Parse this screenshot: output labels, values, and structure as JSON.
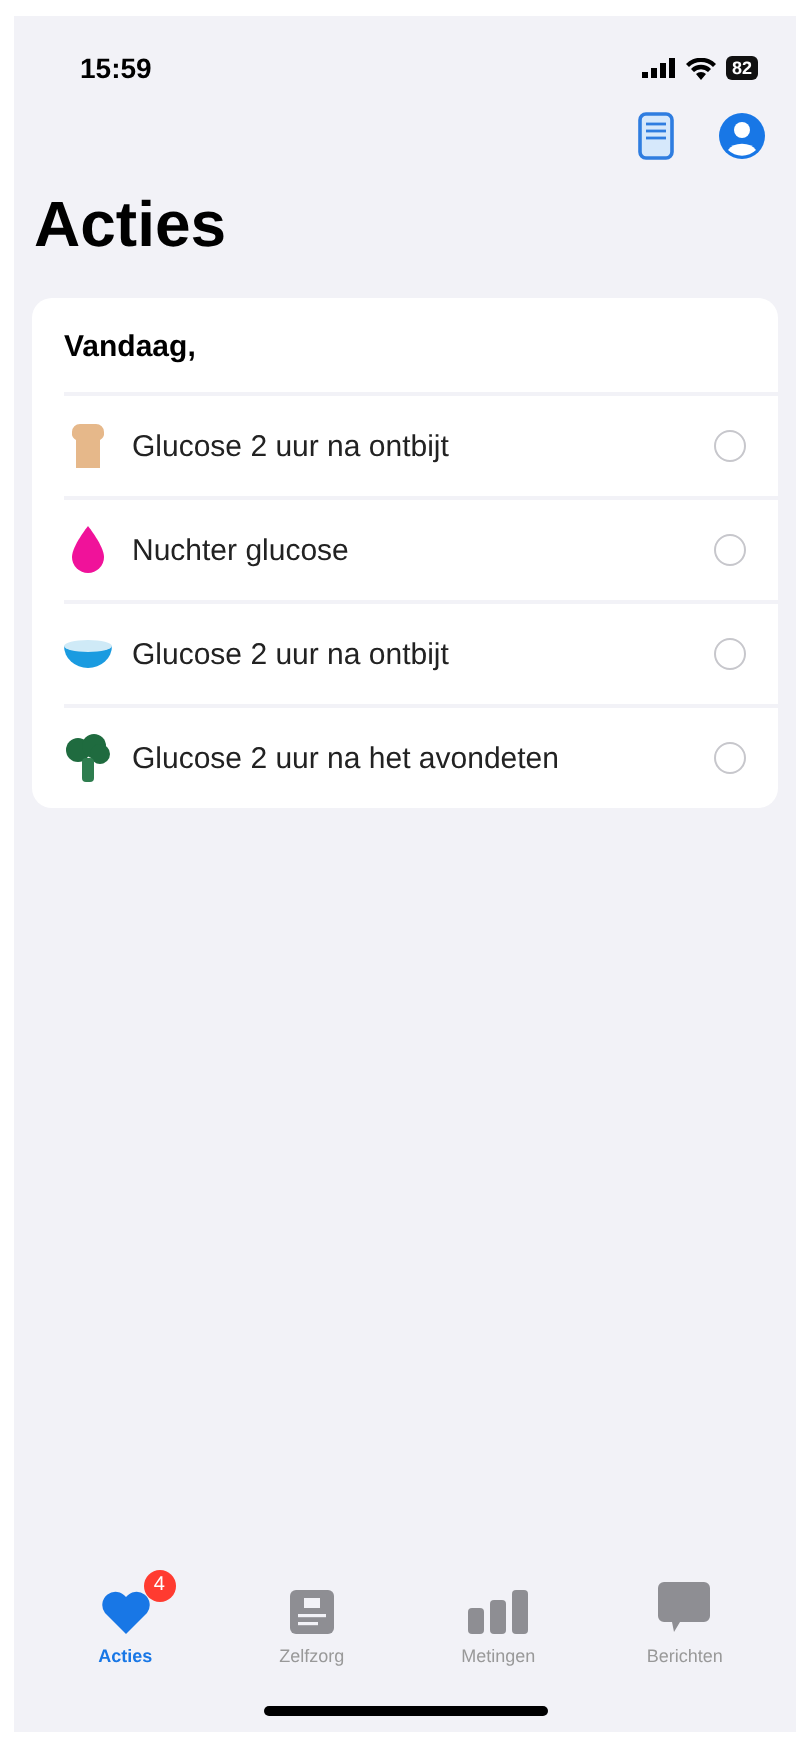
{
  "status_bar": {
    "time": "15:59",
    "battery": "82"
  },
  "title": "Acties",
  "section": {
    "heading": "Vandaag,",
    "items": [
      {
        "kind": "bread",
        "label": "Glucose 2 uur na ontbijt",
        "checked": false
      },
      {
        "kind": "drop",
        "label": "Nuchter glucose",
        "checked": false
      },
      {
        "kind": "bowl",
        "label": "Glucose 2 uur na ontbijt",
        "checked": false
      },
      {
        "kind": "broccoli",
        "label": "Glucose 2 uur na het avondeten",
        "checked": false
      }
    ]
  },
  "tabs": [
    {
      "kind": "heart",
      "label": "Acties",
      "selected": true,
      "badge": "4"
    },
    {
      "kind": "card",
      "label": "Zelfzorg",
      "selected": false
    },
    {
      "kind": "bars",
      "label": "Metingen",
      "selected": false
    },
    {
      "kind": "bubble",
      "label": "Berichten",
      "selected": false
    }
  ]
}
